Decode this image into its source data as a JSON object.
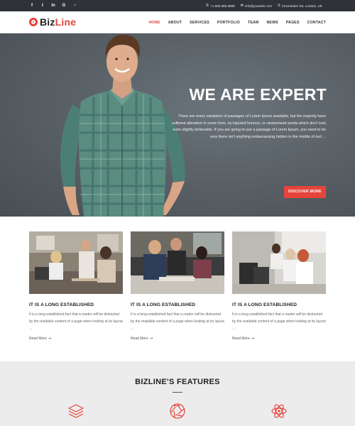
{
  "colors": {
    "accent": "#e5443b",
    "topbar": "#2f3238",
    "hero_bg": "#5a6268",
    "features_bg": "#ececec"
  },
  "topbar": {
    "social": [
      {
        "icon": "facebook-icon",
        "glyph": "f"
      },
      {
        "icon": "twitter-icon",
        "glyph": "t"
      },
      {
        "icon": "linkedin-icon",
        "glyph": "in"
      },
      {
        "icon": "google-icon",
        "glyph": "G"
      },
      {
        "icon": "rss-icon",
        "glyph": "◔"
      }
    ],
    "phone": "+1 888 888 8888",
    "email": "info@yoursite.com",
    "address": "2216 Baker Str, London, UK"
  },
  "header": {
    "logo_prefix": "Biz",
    "logo_suffix": "Line",
    "nav": [
      "HOME",
      "ABOUT",
      "SERVICES",
      "PORTFOLIO",
      "TEAM",
      "NEWS",
      "PAGES",
      "CONTACT"
    ],
    "active_nav": "HOME"
  },
  "hero": {
    "title": "WE ARE EXPERT",
    "text": "There are many variations of passages of Lorem Ipsum available, but the majority have suffered alteration in some form, by injected humour, or randomised words which don't look even slightly believable. If you are going to use a passage of Lorem Ipsum, you need to be sure there isn't anything embarrassing hidden in the middle of text ...",
    "button": "DISCOVER MORE"
  },
  "cards": [
    {
      "title": "IT IS A LONG ESTABLISHED",
      "text": "It is a long established fact that a reader will be distracted by the readable content of a page when looking at its layout ...",
      "more": "Read More"
    },
    {
      "title": "IT IS A LONG ESTABLISHED",
      "text": "It is a long established fact that a reader will be distracted by the readable content of a page when looking at its layout ...",
      "more": "Read More"
    },
    {
      "title": "IT IS A LONG ESTABLISHED",
      "text": "It is a long established fact that a reader will be distracted by the readable content of a page when looking at its layout ...",
      "more": "Read More"
    }
  ],
  "features": {
    "title": "BIZLINE'S FEATURES",
    "icons": [
      "layers-icon",
      "aperture-icon",
      "atom-icon"
    ]
  }
}
